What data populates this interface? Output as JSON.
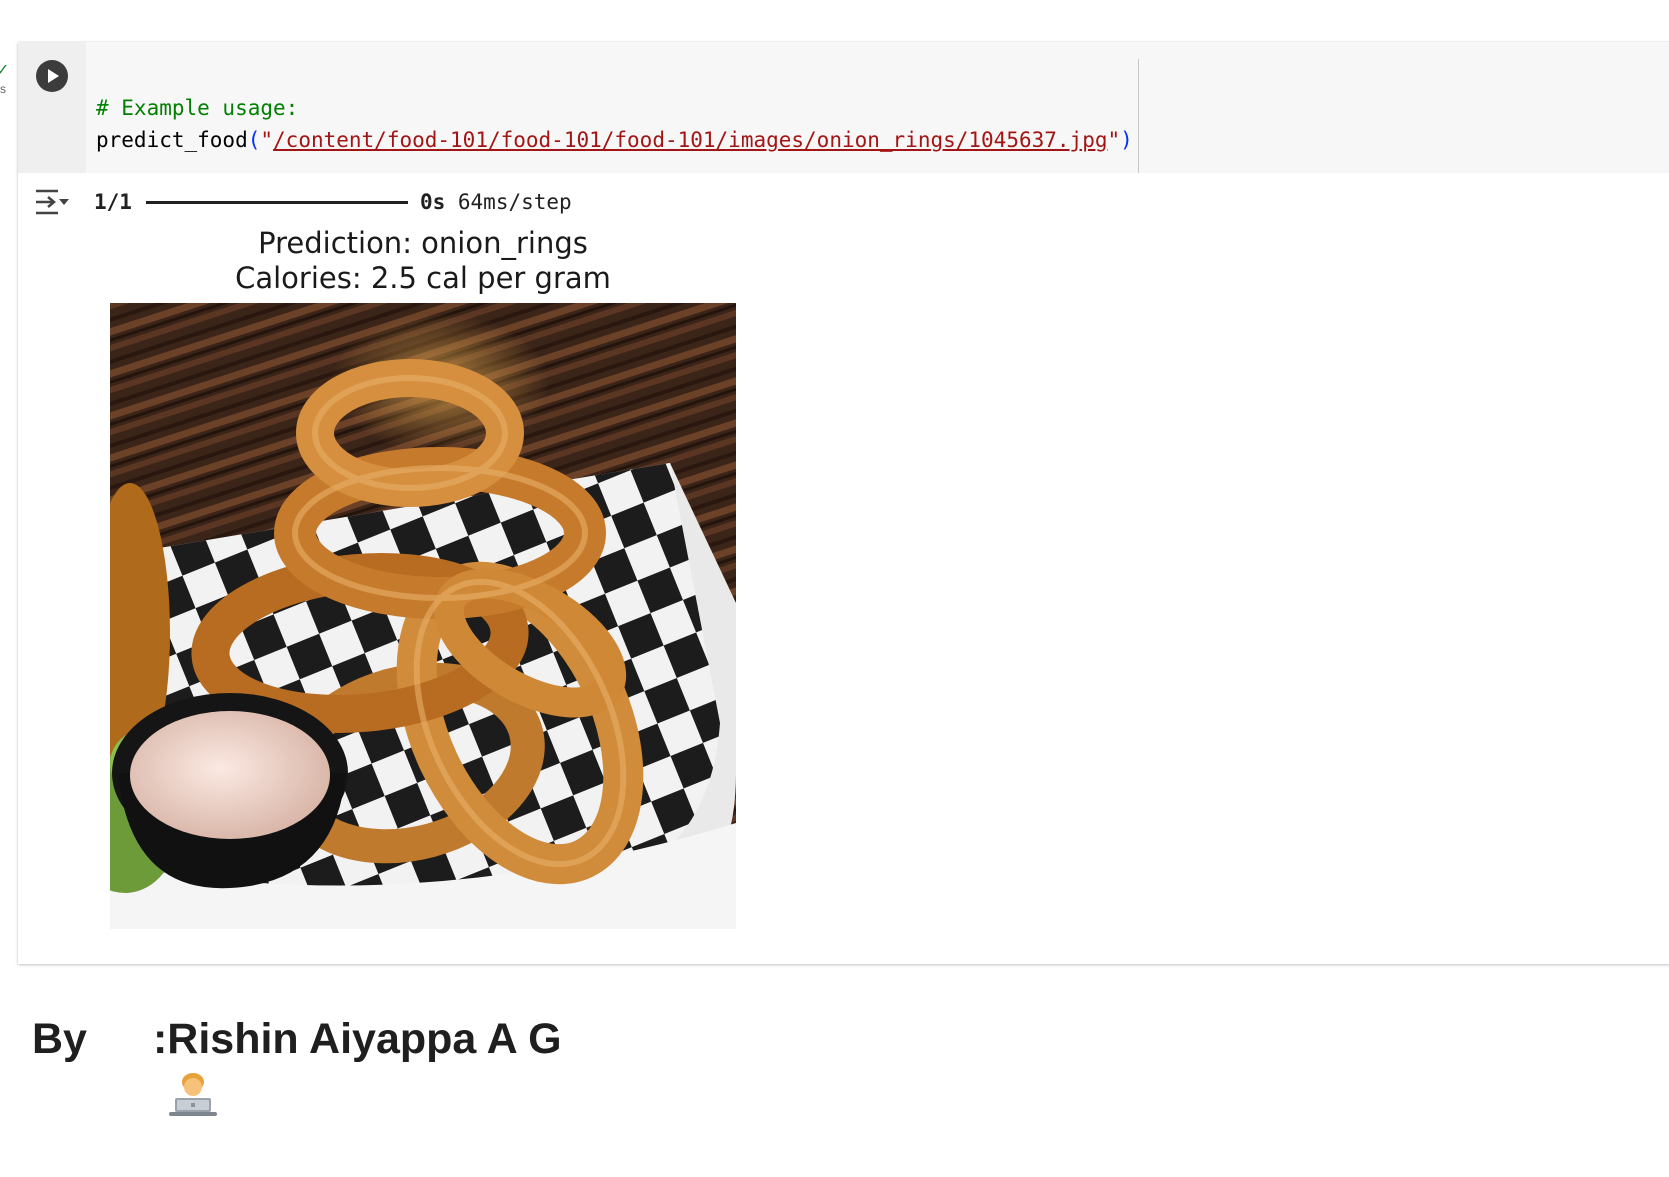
{
  "gutter": {
    "status_mark": "✓",
    "elapsed_fragment": "s"
  },
  "code_cell": {
    "run_button_icon": "play-icon",
    "comment": "# Example usage:",
    "function_name": "predict_food",
    "open_paren": "(",
    "quote_open": "\"",
    "path": "/content/food-101/food-101/food-101/images/onion_rings/1045637.jpg",
    "quote_close": "\"",
    "close_paren": ")"
  },
  "output": {
    "toggle_icon": "output-toggle-icon",
    "progress_steps": "1/1",
    "progress_fraction": 1.0,
    "progress_time": "0s",
    "progress_rate": "64ms/step",
    "title_line1": "Prediction: onion_rings",
    "title_line2": "Calories: 2.5 cal per gram",
    "image_subject": "onion rings with dipping sauce on checkered paper"
  },
  "markdown": {
    "prefix": "By",
    "emoji": "technologist-emoji",
    "author": ":Rishin Aiyappa A G"
  },
  "colors": {
    "comment": "#008000",
    "string": "#a31515",
    "paren": "#0431fa",
    "run_button": "#3c3c3c",
    "status_check": "#188038"
  }
}
